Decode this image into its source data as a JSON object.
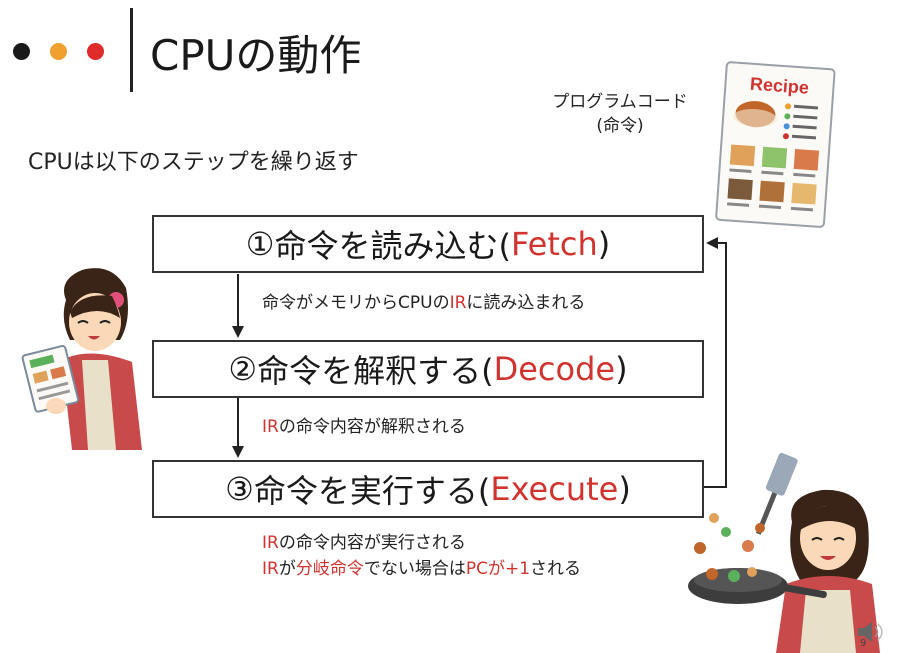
{
  "header": {
    "title": "CPUの動作",
    "dots": [
      "#1a1a1a",
      "#f0a030",
      "#e02b2b"
    ]
  },
  "intro": "CPUは以下のステップを繰り返す",
  "program_code": {
    "label_line1": "プログラムコード",
    "label_line2": "(命令)",
    "recipe_title": "Recipe"
  },
  "steps": [
    {
      "number": "①",
      "text": "命令を読み込む(",
      "keyword": "Fetch",
      "close": ")"
    },
    {
      "number": "②",
      "text": "命令を解釈する(",
      "keyword": "Decode",
      "close": ")"
    },
    {
      "number": "③",
      "text": "命令を実行する(",
      "keyword": "Execute",
      "close": ")"
    }
  ],
  "descriptions": {
    "fetch": {
      "pre": "命令がメモリからCPUの",
      "ir": "IR",
      "post": "に読み込まれる"
    },
    "decode": {
      "ir": "IR",
      "post": "の命令内容が解釈される"
    },
    "execute_line1": {
      "ir": "IR",
      "post": "の命令内容が実行される"
    },
    "execute_line2": {
      "ir": "IR",
      "mid1": "が",
      "branch": "分岐命令",
      "mid2": "でない場合は",
      "pc": "PCが+1",
      "post": "される"
    }
  },
  "accent_color": "#d1342f",
  "page_number": "9"
}
